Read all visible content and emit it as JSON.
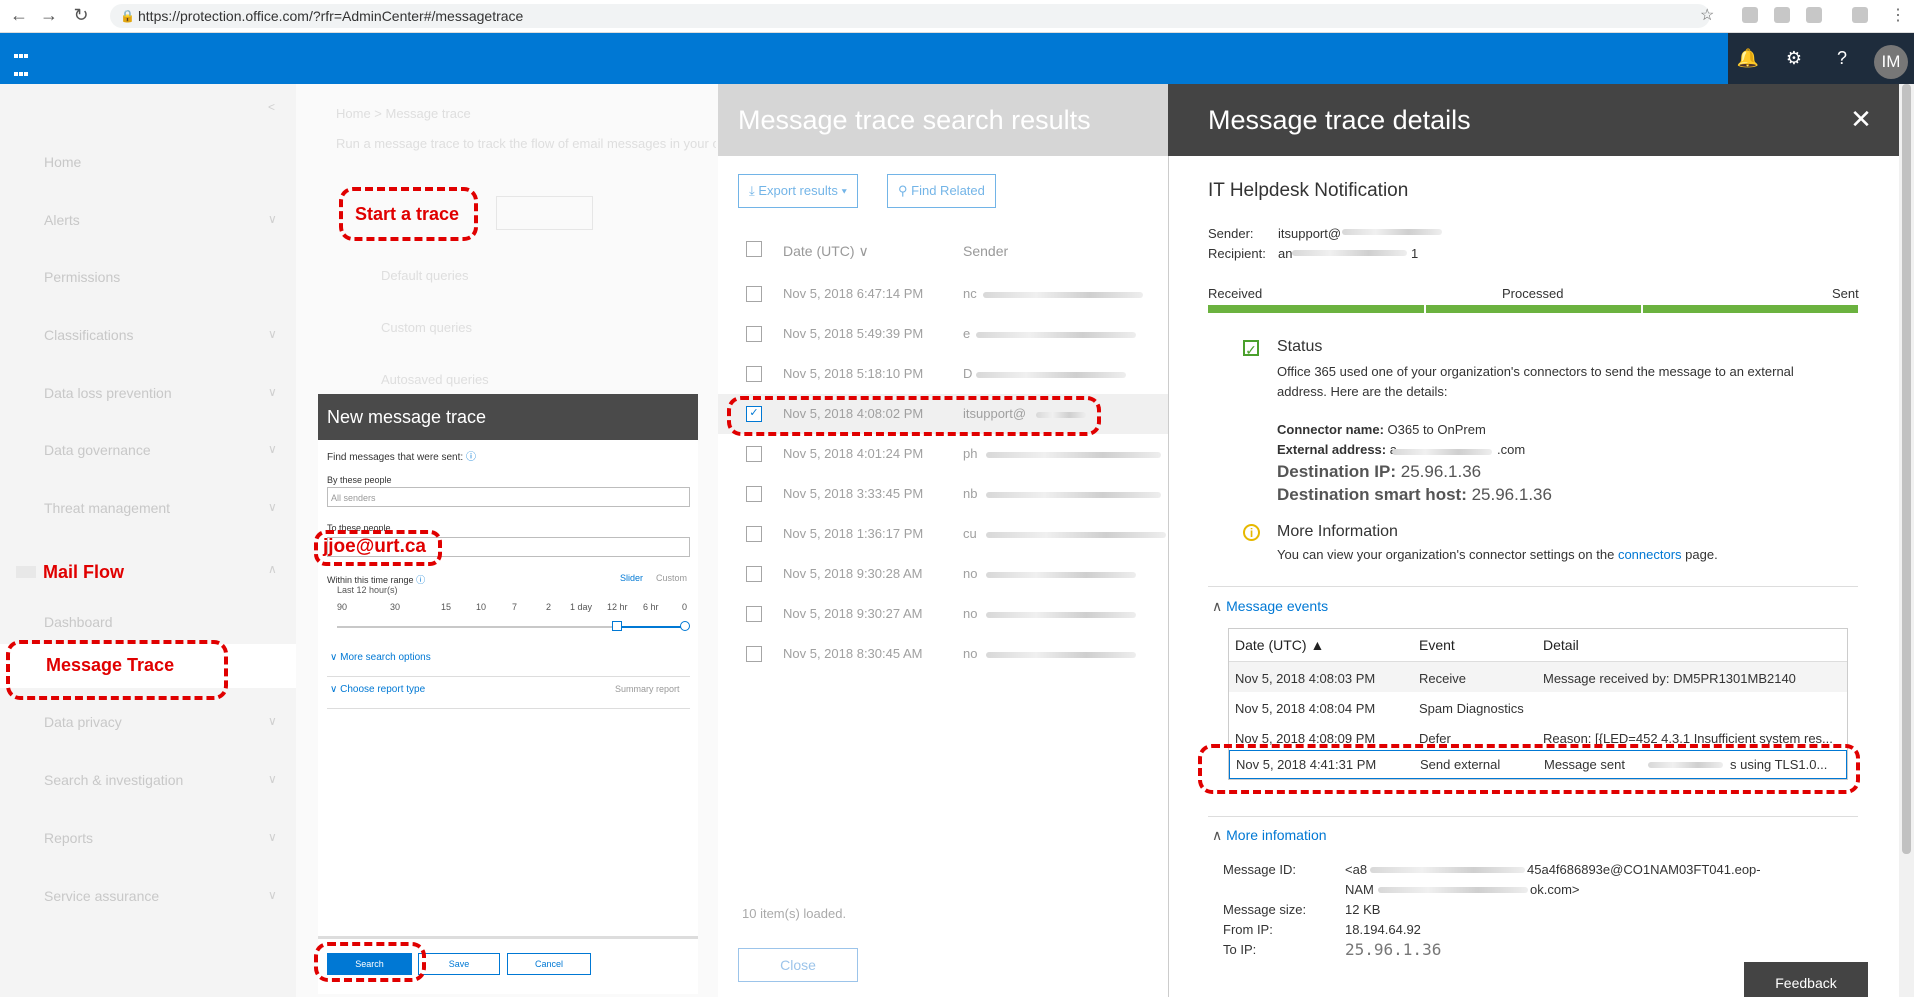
{
  "browser": {
    "url": "https://protection.office.com/?rfr=AdminCenter#/messagetrace"
  },
  "topbar": {
    "avatar_initials": "IM",
    "icons": [
      "bell-icon",
      "gear-icon",
      "help-icon"
    ]
  },
  "left_nav": {
    "items": [
      "Home",
      "Alerts",
      "Permissions",
      "Classifications",
      "Data loss prevention",
      "Data governance",
      "Threat management",
      "Mail Flow",
      "Dashboard",
      "Message Trace",
      "Data privacy",
      "Search & investigation",
      "Reports",
      "Service assurance"
    ]
  },
  "middle_bg": {
    "breadcrumb": "Home > Message trace",
    "description": "Run a message trace to track the flow of email messages in your organization",
    "start_trace": "Start a trace",
    "default_queries": "Default queries",
    "custom_queries": "Custom queries",
    "autosaved_queries": "Autosaved queries"
  },
  "new_trace": {
    "title": "New message trace",
    "find_label": "Find messages that were sent:",
    "by_people_label": "By these people",
    "by_people_placeholder": "All senders",
    "to_people_label": "To these people",
    "time_range_label": "Within this time range",
    "last_hours": "Last 12 hour(s)",
    "slider_link": "Slider",
    "custom_link": "Custom",
    "ticks": [
      "90",
      "30",
      "15",
      "10",
      "7",
      "2",
      "1 day",
      "12 hr",
      "6 hr",
      "0"
    ],
    "more_options": "More search options",
    "report_type": "Choose report type",
    "report_type_value": "Summary report",
    "search_btn": "Search",
    "save_btn": "Save",
    "cancel_btn": "Cancel"
  },
  "results": {
    "title": "Message trace search results",
    "export_btn": "Export results",
    "related_btn": "Find Related",
    "col_date": "Date (UTC)",
    "col_sender": "Sender",
    "rows": [
      {
        "date": "Nov 5, 2018 6:47:14 PM",
        "sender": "nc"
      },
      {
        "date": "Nov 5, 2018 5:49:39 PM",
        "sender": "e"
      },
      {
        "date": "Nov 5, 2018 5:18:10 PM",
        "sender": "D"
      },
      {
        "date": "Nov 5, 2018 4:08:02 PM",
        "sender": "itsupport@"
      },
      {
        "date": "Nov 5, 2018 4:01:24 PM",
        "sender": "ph"
      },
      {
        "date": "Nov 5, 2018 3:33:45 PM",
        "sender": "nb"
      },
      {
        "date": "Nov 5, 2018 1:36:17 PM",
        "sender": "cu"
      },
      {
        "date": "Nov 5, 2018 9:30:28 AM",
        "sender": "no"
      },
      {
        "date": "Nov 5, 2018 9:30:27 AM",
        "sender": "no"
      },
      {
        "date": "Nov 5, 2018 8:30:45 AM",
        "sender": "no"
      }
    ],
    "loaded": "10 item(s) loaded.",
    "close_btn": "Close"
  },
  "details": {
    "title": "Message trace details",
    "subject": "IT Helpdesk Notification",
    "sender_label": "Sender:",
    "sender_value": "itsupport@",
    "recipient_label": "Recipient:",
    "recipient_value": "an",
    "recipient_tail": "1",
    "stages": [
      "Received",
      "Processed",
      "Sent"
    ],
    "status_title": "Status",
    "status_text": "Office 365 used one of your organization's connectors to send the message to an external address. Here are the details:",
    "connector_label": "Connector name:",
    "connector_value": "O365 to OnPrem",
    "external_label": "External address:",
    "external_value": "a",
    "external_tail": ".com",
    "dest_ip_label": "Destination IP:",
    "dest_ip_value": "25.96.1.36",
    "dest_host_label": "Destination smart host:",
    "dest_host_value": "25.96.1.36",
    "more_info_title": "More Information",
    "more_info_text": "You can view your organization's connector settings on the",
    "more_info_link": "connectors",
    "more_info_tail": "page.",
    "events_title": "Message events",
    "events_cols": [
      "Date (UTC)",
      "Event",
      "Detail"
    ],
    "events": [
      {
        "date": "Nov 5, 2018 4:08:03 PM",
        "event": "Receive",
        "detail": "Message received by: DM5PR1301MB2140"
      },
      {
        "date": "Nov 5, 2018 4:08:04 PM",
        "event": "Spam Diagnostics",
        "detail": ""
      },
      {
        "date": "Nov 5, 2018 4:08:09 PM",
        "event": "Defer",
        "detail": "Reason: [{LED=452 4.3.1 Insufficient system res..."
      },
      {
        "date": "Nov 5, 2018 4:41:31 PM",
        "event": "Send external",
        "detail": "Message sent"
      }
    ],
    "event_detail_tail": "s using TLS1.0...",
    "more_infomation_title": "More infomation",
    "message_id_label": "Message ID:",
    "message_id_a": "<a8",
    "message_id_b": "45a4f686893e@CO1NAM03FT041.eop-",
    "message_id_c": "NAM",
    "message_id_d": "ok.com>",
    "size_label": "Message size:",
    "size_value": "12 KB",
    "from_ip_label": "From IP:",
    "from_ip_value": "18.194.64.92",
    "to_ip_label": "To IP:",
    "to_ip_value": "25.96.1.36",
    "feedback": "Feedback"
  },
  "annotations": {
    "start_trace": "Start a trace",
    "email": "jjoe@urt.ca",
    "mail_flow": "Mail Flow",
    "message_trace": "Message Trace"
  },
  "colors": {
    "brand_blue": "#0078d4",
    "annotation_red": "#e00000",
    "progress_green": "#6bb23f"
  }
}
